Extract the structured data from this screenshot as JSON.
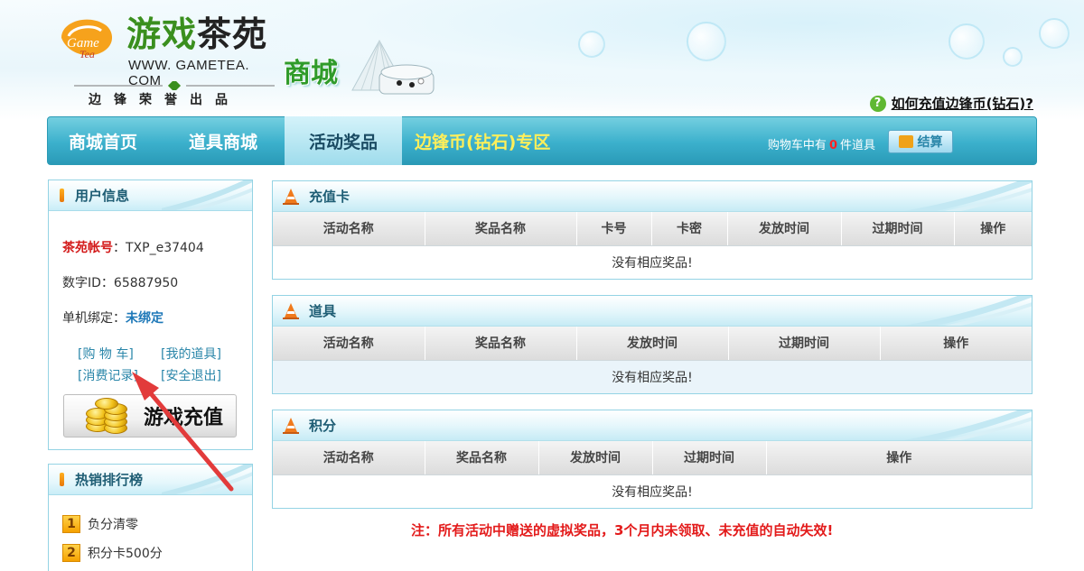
{
  "header": {
    "logo_mark": "Game Tea",
    "logo_title_part1": "游戏",
    "logo_title_part2": "茶苑",
    "logo_url": "WWW. GAMETEA. COM",
    "logo_slogan": "边锋荣誉出品",
    "shop_title": "商城",
    "help_link": "如何充值边锋币(钻石)?"
  },
  "nav": {
    "items": [
      {
        "label": "商城首页"
      },
      {
        "label": "道具商城"
      },
      {
        "label": "活动奖品"
      },
      {
        "label": "边锋币(钻石)专区"
      }
    ],
    "cart_prefix": "购物车中有",
    "cart_count": "0",
    "cart_suffix": "件道具",
    "checkout_label": "结算"
  },
  "user_panel": {
    "title": "用户信息",
    "account_label": "茶苑帐号",
    "account_value": "TXP_e37404",
    "numeric_id_label": "数字ID：",
    "numeric_id_value": "65887950",
    "bind_label": "单机绑定：",
    "bind_value": "未绑定",
    "links": [
      "[购 物 车]",
      "[我的道具]",
      "[消费记录]",
      "[安全退出]"
    ],
    "recharge_label": "游戏充值"
  },
  "rank_panel": {
    "title": "热销排行榜",
    "items": [
      {
        "rank": "1",
        "label": "负分清零"
      },
      {
        "rank": "2",
        "label": "积分卡500分"
      }
    ]
  },
  "sections": [
    {
      "title": "充值卡",
      "columns": [
        "活动名称",
        "奖品名称",
        "卡号",
        "卡密",
        "发放时间",
        "过期时间",
        "操作"
      ],
      "empty_text": "没有相应奖品!"
    },
    {
      "title": "道具",
      "columns": [
        "活动名称",
        "奖品名称",
        "发放时间",
        "过期时间",
        "操作"
      ],
      "empty_text": "没有相应奖品!"
    },
    {
      "title": "积分",
      "columns": [
        "活动名称",
        "奖品名称",
        "发放时间",
        "过期时间",
        "操作"
      ],
      "empty_text": "没有相应奖品!"
    }
  ],
  "note": "注：所有活动中赠送的虚拟奖品，3个月内未领取、未充值的自动失效!",
  "colors": {
    "nav_bg": "#3bb0cc",
    "accent_red": "#e31b1b",
    "link_blue": "#2a86a9",
    "coin_yellow": "#ffef5a"
  }
}
